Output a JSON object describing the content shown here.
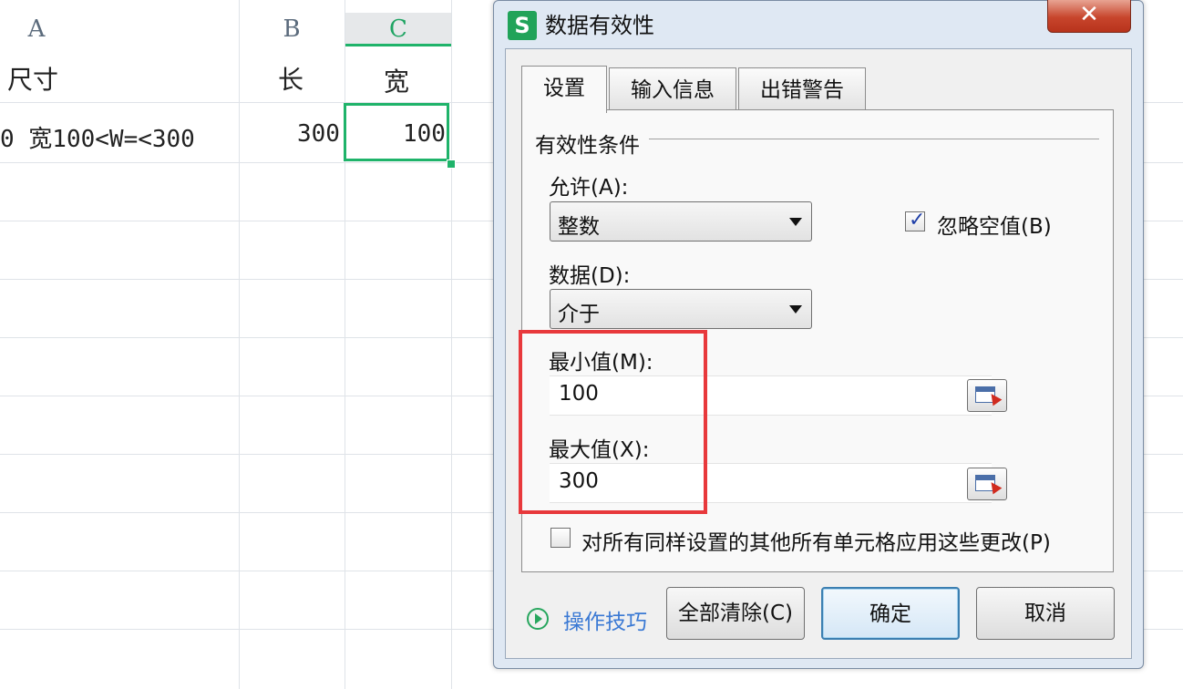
{
  "sheet": {
    "columns": [
      "A",
      "B",
      "C"
    ],
    "row1": {
      "a": "尺寸",
      "b": "长",
      "c": "宽"
    },
    "row2": {
      "a": "0 宽100<W=<300",
      "b": "300",
      "c": "100"
    }
  },
  "dialog": {
    "app_icon": "S",
    "title": "数据有效性",
    "close_symbol": "✕",
    "tabs": [
      "设置",
      "输入信息",
      "出错警告"
    ],
    "group_label": "有效性条件",
    "allow_label": "允许(A):",
    "allow_value": "整数",
    "ignore_blank_label": "忽略空值(B)",
    "ignore_blank_checked": true,
    "data_label": "数据(D):",
    "data_value": "介于",
    "min_label": "最小值(M):",
    "min_value": "100",
    "max_label": "最大值(X):",
    "max_value": "300",
    "apply_all_label": "对所有同样设置的其他所有单元格应用这些更改(P)",
    "apply_all_checked": false,
    "tips_label": "操作技巧",
    "buttons": {
      "clear": "全部清除(C)",
      "ok": "确定",
      "cancel": "取消"
    }
  },
  "colors": {
    "selection": "#1fb36a",
    "highlight": "#e8393c",
    "link": "#3a79d4",
    "app_icon": "#21a359"
  },
  "icons": [
    "app-s-icon",
    "close-icon",
    "dropdown-arrow-icon",
    "range-select-icon",
    "checkbox-icon",
    "play-circle-icon"
  ]
}
